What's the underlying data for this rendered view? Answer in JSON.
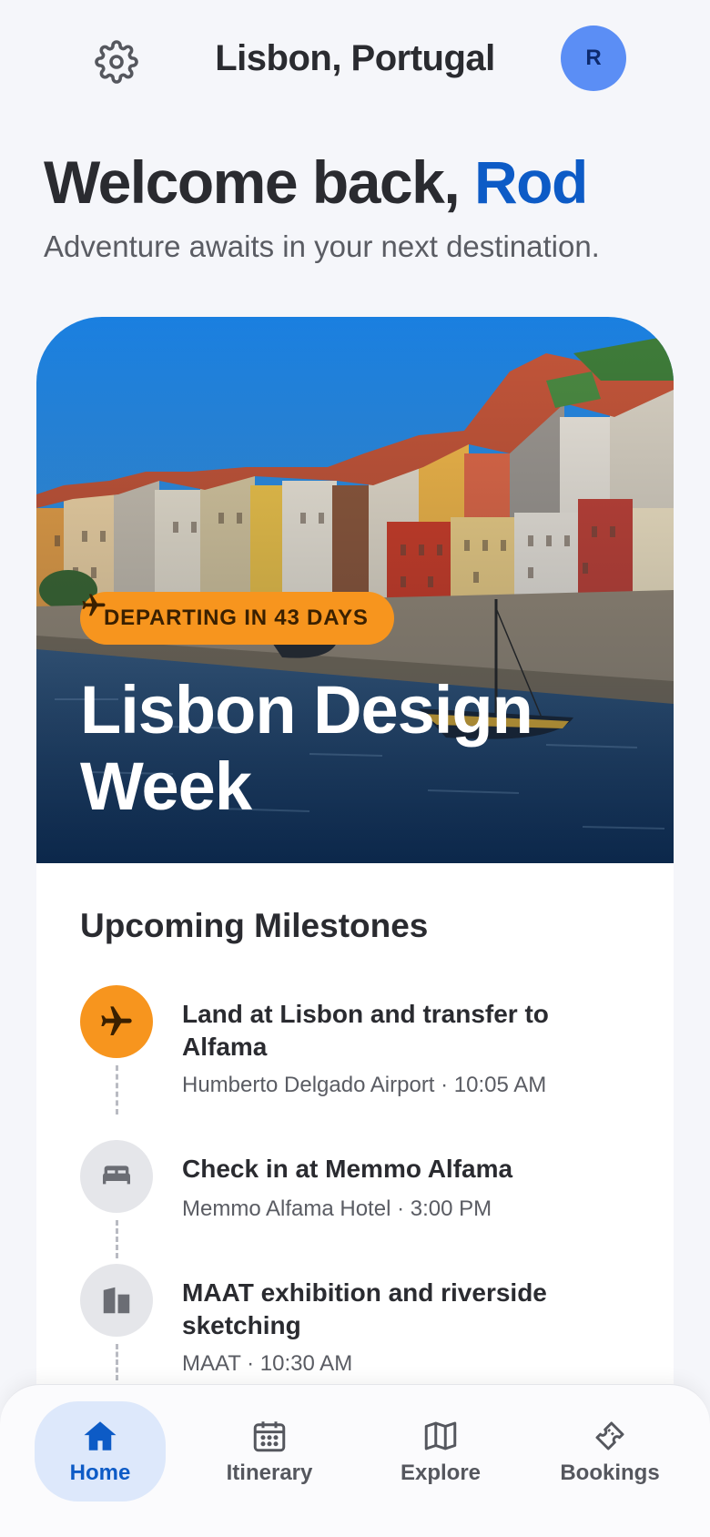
{
  "header": {
    "location_title": "Lisbon, Portugal",
    "avatar_initial": "R",
    "settings_icon": "gear-icon"
  },
  "welcome": {
    "greeting": "Welcome back, ",
    "name": "Rod",
    "tagline": "Adventure awaits in your next destination."
  },
  "trip": {
    "badge_icon": "airplane-icon",
    "badge_text": "DEPARTING IN 43 DAYS",
    "title": "Lisbon Design Week"
  },
  "milestones": {
    "heading": "Upcoming Milestones",
    "items": [
      {
        "icon": "airplane-icon",
        "title": "Land at Lisbon and transfer to Alfama",
        "subtitle": "Humberto Delgado Airport · 10:05 AM"
      },
      {
        "icon": "bed-icon",
        "title": "Check in at Memmo Alfama",
        "subtitle": "Memmo Alfama Hotel · 3:00 PM"
      },
      {
        "icon": "building-icon",
        "title": "MAAT exhibition and riverside sketching",
        "subtitle": "MAAT · 10:30 AM"
      }
    ]
  },
  "nav": {
    "items": [
      {
        "label": "Home",
        "icon": "home-icon",
        "active": true
      },
      {
        "label": "Itinerary",
        "icon": "calendar-icon",
        "active": false
      },
      {
        "label": "Explore",
        "icon": "map-icon",
        "active": false
      },
      {
        "label": "Bookings",
        "icon": "ticket-icon",
        "active": false
      }
    ]
  },
  "colors": {
    "accent_blue": "#0d5bc6",
    "accent_orange": "#f7951e",
    "avatar_blue": "#5b8ef5",
    "background": "#f5f6fa"
  }
}
